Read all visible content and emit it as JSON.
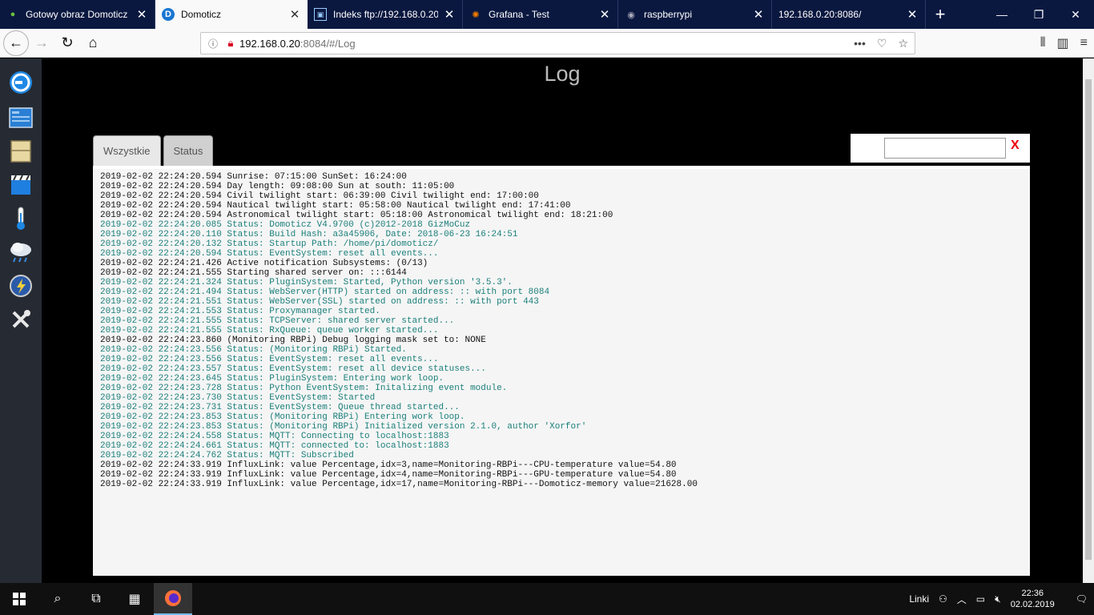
{
  "browser": {
    "tabs": [
      {
        "title": "Gotowy obraz Domoticz",
        "icon": "raspberry-icon"
      },
      {
        "title": "Domoticz",
        "icon": "domoticz-icon"
      },
      {
        "title": "Indeks ftp://192.168.0.20/",
        "icon": "folder-icon"
      },
      {
        "title": "Grafana - Test",
        "icon": "grafana-icon"
      },
      {
        "title": "raspberrypi",
        "icon": "globe-icon"
      },
      {
        "title": "192.168.0.20:8086/",
        "icon": "blank-icon"
      }
    ],
    "url_host": "192.168.0.20",
    "url_path": ":8084/#/Log"
  },
  "page": {
    "title": "Log",
    "tabs": [
      "Wszystkie",
      "Status"
    ],
    "filter_value": "",
    "clear_label": "X"
  },
  "log": [
    {
      "text": "2019-02-02 22:24:20.594 Sunrise: 07:15:00 SunSet: 16:24:00",
      "status": false
    },
    {
      "text": "2019-02-02 22:24:20.594 Day length: 09:08:00 Sun at south: 11:05:00",
      "status": false
    },
    {
      "text": "2019-02-02 22:24:20.594 Civil twilight start: 06:39:00 Civil twilight end: 17:00:00",
      "status": false
    },
    {
      "text": "2019-02-02 22:24:20.594 Nautical twilight start: 05:58:00 Nautical twilight end: 17:41:00",
      "status": false
    },
    {
      "text": "2019-02-02 22:24:20.594 Astronomical twilight start: 05:18:00 Astronomical twilight end: 18:21:00",
      "status": false
    },
    {
      "text": "2019-02-02 22:24:20.085 Status: Domoticz V4.9700 (c)2012-2018 GizMoCuz",
      "status": true
    },
    {
      "text": "2019-02-02 22:24:20.110 Status: Build Hash: a3a45906, Date: 2018-06-23 16:24:51",
      "status": true
    },
    {
      "text": "2019-02-02 22:24:20.132 Status: Startup Path: /home/pi/domoticz/",
      "status": true
    },
    {
      "text": "2019-02-02 22:24:20.594 Status: EventSystem: reset all events...",
      "status": true
    },
    {
      "text": "2019-02-02 22:24:21.426 Active notification Subsystems: (0/13)",
      "status": false
    },
    {
      "text": "2019-02-02 22:24:21.555 Starting shared server on: :::6144",
      "status": false
    },
    {
      "text": "2019-02-02 22:24:21.324 Status: PluginSystem: Started, Python version '3.5.3'.",
      "status": true
    },
    {
      "text": "2019-02-02 22:24:21.494 Status: WebServer(HTTP) started on address: :: with port 8084",
      "status": true
    },
    {
      "text": "2019-02-02 22:24:21.551 Status: WebServer(SSL) started on address: :: with port 443",
      "status": true
    },
    {
      "text": "2019-02-02 22:24:21.553 Status: Proxymanager started.",
      "status": true
    },
    {
      "text": "2019-02-02 22:24:21.555 Status: TCPServer: shared server started...",
      "status": true
    },
    {
      "text": "2019-02-02 22:24:21.555 Status: RxQueue: queue worker started...",
      "status": true
    },
    {
      "text": "2019-02-02 22:24:23.860 (Monitoring RBPi) Debug logging mask set to: NONE",
      "status": false
    },
    {
      "text": "2019-02-02 22:24:23.556 Status: (Monitoring RBPi) Started.",
      "status": true
    },
    {
      "text": "2019-02-02 22:24:23.556 Status: EventSystem: reset all events...",
      "status": true
    },
    {
      "text": "2019-02-02 22:24:23.557 Status: EventSystem: reset all device statuses...",
      "status": true
    },
    {
      "text": "2019-02-02 22:24:23.645 Status: PluginSystem: Entering work loop.",
      "status": true
    },
    {
      "text": "2019-02-02 22:24:23.728 Status: Python EventSystem: Initalizing event module.",
      "status": true
    },
    {
      "text": "2019-02-02 22:24:23.730 Status: EventSystem: Started",
      "status": true
    },
    {
      "text": "2019-02-02 22:24:23.731 Status: EventSystem: Queue thread started...",
      "status": true
    },
    {
      "text": "2019-02-02 22:24:23.853 Status: (Monitoring RBPi) Entering work loop.",
      "status": true
    },
    {
      "text": "2019-02-02 22:24:23.853 Status: (Monitoring RBPi) Initialized version 2.1.0, author 'Xorfor'",
      "status": true
    },
    {
      "text": "2019-02-02 22:24:24.558 Status: MQTT: Connecting to localhost:1883",
      "status": true
    },
    {
      "text": "2019-02-02 22:24:24.661 Status: MQTT: connected to: localhost:1883",
      "status": true
    },
    {
      "text": "2019-02-02 22:24:24.762 Status: MQTT: Subscribed",
      "status": true
    },
    {
      "text": "2019-02-02 22:24:33.919 InfluxLink: value Percentage,idx=3,name=Monitoring-RBPi---CPU-temperature value=54.80",
      "status": false
    },
    {
      "text": "2019-02-02 22:24:33.919 InfluxLink: value Percentage,idx=4,name=Monitoring-RBPi---GPU-temperature value=54.80",
      "status": false
    },
    {
      "text": "2019-02-02 22:24:33.919 InfluxLink: value Percentage,idx=17,name=Monitoring-RBPi---Domoticz-memory value=21628.00",
      "status": false
    }
  ],
  "sidebar": [
    "domoticz-logo-icon",
    "dashboard-icon",
    "floorplan-icon",
    "scenes-icon",
    "temperature-icon",
    "weather-icon",
    "utility-icon",
    "setup-icon"
  ],
  "taskbar": {
    "links_label": "Linki",
    "time": "22:36",
    "date": "02.02.2019"
  },
  "colors": {
    "status_text": "#1a7f7a",
    "normal_text": "#111111",
    "clear_button": "#ee0000"
  }
}
